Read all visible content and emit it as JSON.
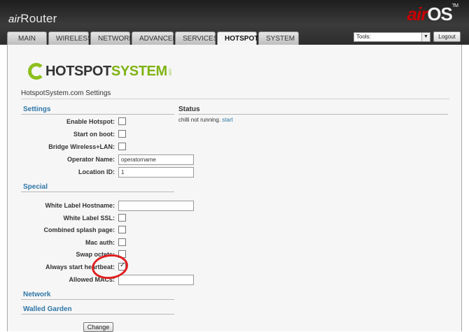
{
  "brand": {
    "air": "air",
    "router": "Router"
  },
  "airos": {
    "air": "air",
    "os": "OS",
    "tm": "TM"
  },
  "tabs": [
    {
      "label": "MAIN"
    },
    {
      "label": "WIRELESS"
    },
    {
      "label": "NETWORK"
    },
    {
      "label": "ADVANCED"
    },
    {
      "label": "SERVICES"
    },
    {
      "label": "HOTSPOT",
      "active": true
    },
    {
      "label": "SYSTEM"
    }
  ],
  "tools": {
    "label": "Tools:",
    "arrow": "▼"
  },
  "logout_label": "Logout",
  "logo": {
    "hotspot": "HOTSPOT",
    "system": "SYSTEM",
    "com": ".com"
  },
  "page_title": "HotspotSystem.com Settings",
  "settings_heading": "Settings",
  "status_heading": "Status",
  "status": {
    "text": "chilli not running.",
    "link": "start"
  },
  "settings": {
    "enable_hotspot": {
      "label": "Enable Hotspot:",
      "checked": false
    },
    "start_on_boot": {
      "label": "Start on boot:",
      "checked": false
    },
    "bridge": {
      "label": "Bridge Wireless+LAN:",
      "checked": false
    },
    "operator_name": {
      "label": "Operator Name:",
      "value": "operatorname"
    },
    "location_id": {
      "label": "Location ID:",
      "value": "1"
    }
  },
  "special_heading": "Special",
  "special": {
    "white_label_hostname": {
      "label": "White Label Hostname:",
      "value": ""
    },
    "white_label_ssl": {
      "label": "White Label SSL:",
      "checked": false
    },
    "combined_splash": {
      "label": "Combined splash page:",
      "checked": false
    },
    "mac_auth": {
      "label": "Mac auth:",
      "checked": false
    },
    "swap_octets": {
      "label": "Swap octets:",
      "checked": false
    },
    "always_heartbeat": {
      "label": "Always start heartbeat:",
      "checked": true
    },
    "allowed_macs": {
      "label": "Allowed MACs:",
      "value": ""
    }
  },
  "network_heading": "Network",
  "walled_garden_heading": "Walled Garden",
  "change_label": "Change",
  "colors": {
    "accent": "#2f76a7",
    "header": "#2b2b2b",
    "annotation": "#e02020"
  }
}
